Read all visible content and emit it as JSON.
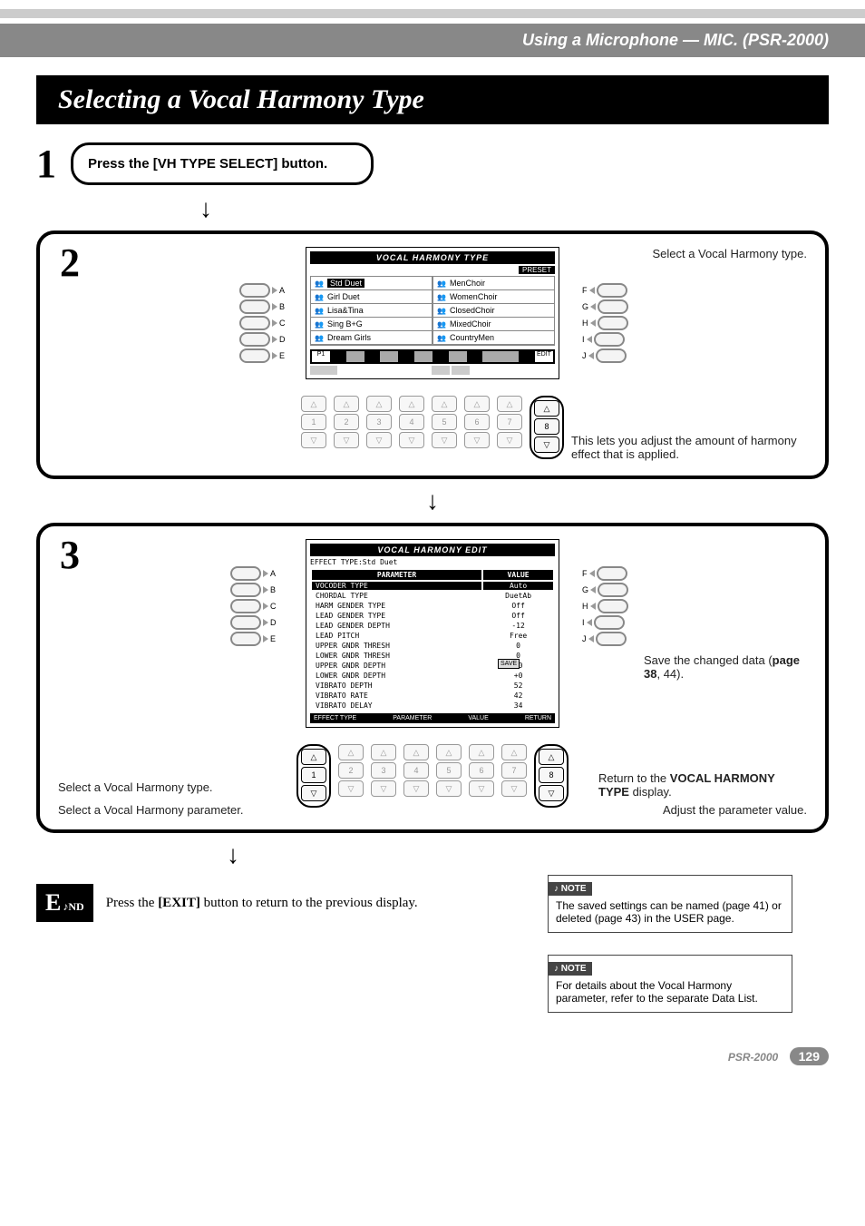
{
  "header": {
    "breadcrumb": "Using a Microphone — MIC. (PSR-2000)"
  },
  "title": "Selecting a Vocal Harmony Type",
  "step1": {
    "num": "1",
    "text": "Press the [VH TYPE SELECT] button."
  },
  "step2": {
    "num": "2",
    "screen_title": "VOCAL HARMONY TYPE",
    "preset_tab": "PRESET",
    "left_col": [
      "Std Duet",
      "Girl Duet",
      "Lisa&Tina",
      "Sing B+G",
      "Dream Girls"
    ],
    "right_col": [
      "MenChoir",
      "WomenChoir",
      "ClosedChoir",
      "MixedChoir",
      "CountryMen"
    ],
    "left_letters": [
      "A",
      "B",
      "C",
      "D",
      "E"
    ],
    "right_letters": [
      "F",
      "G",
      "H",
      "I",
      "J"
    ],
    "num_labels": [
      "1",
      "2",
      "3",
      "4",
      "5",
      "6",
      "7",
      "8"
    ],
    "callout_select": "Select a Vocal Harmony type.",
    "callout_effect": "This lets you adjust the amount of harmony effect that is applied.",
    "edit_icon": "EDIT",
    "p1": "P1"
  },
  "step3": {
    "num": "3",
    "screen_title": "VOCAL HARMONY EDIT",
    "effect_type_label": "EFFECT TYPE:Std Duet",
    "col_param": "PARAMETER",
    "col_value": "VALUE",
    "params": [
      [
        "VOCODER TYPE",
        "Auto"
      ],
      [
        "CHORDAL TYPE",
        "DuetAb"
      ],
      [
        "HARM GENDER TYPE",
        "Off"
      ],
      [
        "LEAD GENDER TYPE",
        "Off"
      ],
      [
        "LEAD GENDER DEPTH",
        "-12"
      ],
      [
        "LEAD PITCH",
        "Free"
      ],
      [
        "UPPER GNDR THRESH",
        "0"
      ],
      [
        "LOWER GNDR THRESH",
        "0"
      ],
      [
        "UPPER GNDR DEPTH",
        "+0"
      ],
      [
        "LOWER GNDR DEPTH",
        "+0"
      ],
      [
        "VIBRATO DEPTH",
        "52"
      ],
      [
        "VIBRATO RATE",
        "42"
      ],
      [
        "VIBRATO DELAY",
        "34"
      ]
    ],
    "bot_labels": {
      "effect": "EFFECT TYPE",
      "param": "PARAMETER",
      "value": "VALUE",
      "return": "RETURN",
      "save": "SAVE"
    },
    "left_letters": [
      "A",
      "B",
      "C",
      "D",
      "E"
    ],
    "right_letters": [
      "F",
      "G",
      "H",
      "I",
      "J"
    ],
    "num_labels": [
      "1",
      "2",
      "3",
      "4",
      "5",
      "6",
      "7",
      "8"
    ],
    "callout_vhtype": "Select a Vocal Harmony type.",
    "callout_save": "Save the changed data (",
    "callout_save_ref": "page 38",
    "callout_save_tail": ", 44).",
    "callout_return1": "Return to the ",
    "callout_return2": "VOCAL HARMONY TYPE",
    "callout_return3": " display.",
    "callout_param": "Select a Vocal Harmony parameter.",
    "callout_adjust": "Adjust the parameter value."
  },
  "end": {
    "label_e": "E",
    "label_nd": "ND",
    "text1": "Press the ",
    "text_btn": "[EXIT]",
    "text2": " button to return to the previous display."
  },
  "note1": "The saved settings can be named (page 41) or deleted (page 43) in the USER page.",
  "note2": "For details about the Vocal Harmony parameter, refer to the separate Data List.",
  "note_label": "NOTE",
  "footer": {
    "psr": "PSR-2000",
    "page": "129"
  }
}
